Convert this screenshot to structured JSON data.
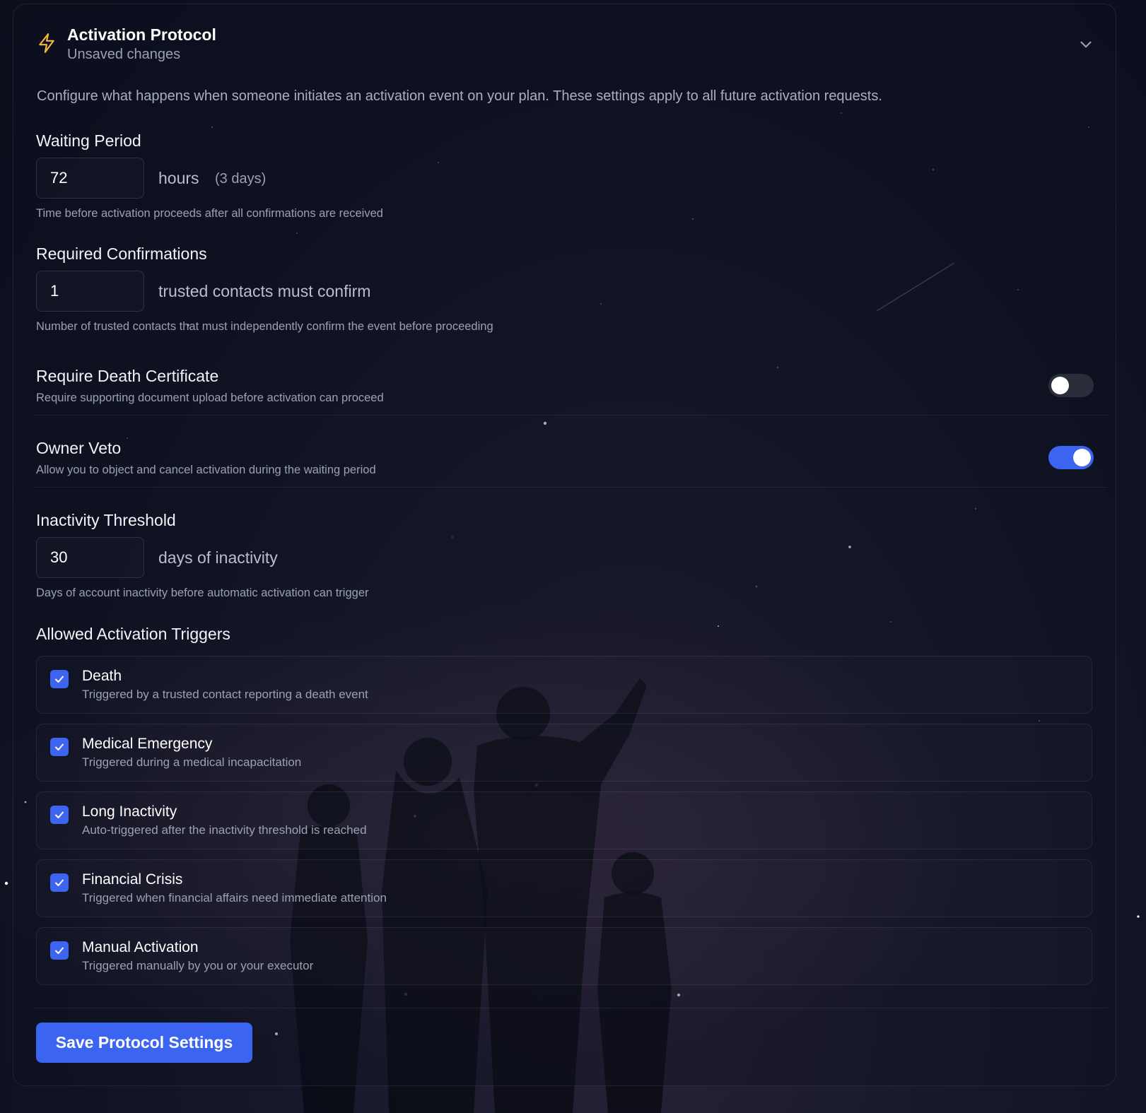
{
  "colors": {
    "accent": "#3b64f0",
    "bolt": "#f3b63f",
    "background": "#0f1222"
  },
  "icons": {
    "header": "bolt-icon",
    "collapse": "chevron-down-icon",
    "check": "check-icon"
  },
  "header": {
    "title": "Activation Protocol",
    "subtitle": "Unsaved changes"
  },
  "description": "Configure what happens when someone initiates an activation event on your plan. These settings apply to all future activation requests.",
  "waiting_period": {
    "label": "Waiting Period",
    "value": "72",
    "unit": "hours",
    "unit_note": "(3 days)",
    "help": "Time before activation proceeds after all confirmations are received"
  },
  "required_confirmations": {
    "label": "Required Confirmations",
    "value": "1",
    "unit": "trusted contacts must confirm",
    "help": "Number of trusted contacts that must independently confirm the event before proceeding"
  },
  "death_certificate": {
    "title": "Require Death Certificate",
    "desc": "Require supporting document upload before activation can proceed",
    "enabled": false
  },
  "owner_veto": {
    "title": "Owner Veto",
    "desc": "Allow you to object and cancel activation during the waiting period",
    "enabled": true
  },
  "inactivity": {
    "label": "Inactivity Threshold",
    "value": "30",
    "unit": "days of inactivity",
    "help": "Days of account inactivity before automatic activation can trigger"
  },
  "triggers": {
    "label": "Allowed Activation Triggers",
    "items": [
      {
        "name": "Death",
        "desc": "Triggered by a trusted contact reporting a death event",
        "checked": true
      },
      {
        "name": "Medical Emergency",
        "desc": "Triggered during a medical incapacitation",
        "checked": true
      },
      {
        "name": "Long Inactivity",
        "desc": "Auto-triggered after the inactivity threshold is reached",
        "checked": true
      },
      {
        "name": "Financial Crisis",
        "desc": "Triggered when financial affairs need immediate attention",
        "checked": true
      },
      {
        "name": "Manual Activation",
        "desc": "Triggered manually by you or your executor",
        "checked": true
      }
    ]
  },
  "save_button": "Save Protocol Settings"
}
